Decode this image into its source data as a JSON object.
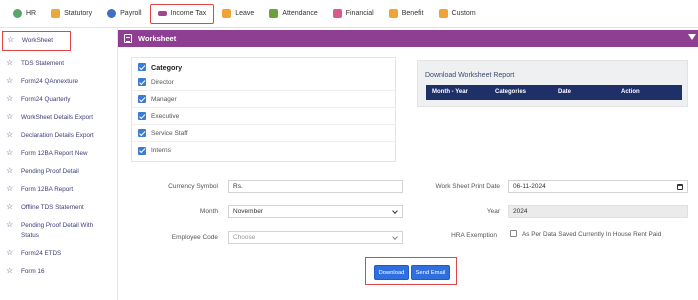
{
  "nav": {
    "items": [
      {
        "label": "HR",
        "icon": "people-icon",
        "color": "#5aa36a"
      },
      {
        "label": "Statutory",
        "icon": "document-icon",
        "color": "#e6a93a"
      },
      {
        "label": "Payroll",
        "icon": "person-money-icon",
        "color": "#3d6fc4"
      },
      {
        "label": "Income Tax",
        "icon": "tax-icon",
        "color": "#9b4a8f"
      },
      {
        "label": "Leave",
        "icon": "leave-icon",
        "color": "#f0a336"
      },
      {
        "label": "Attendance",
        "icon": "attendance-icon",
        "color": "#6aa33a"
      },
      {
        "label": "Financial",
        "icon": "financial-icon",
        "color": "#d95a8a"
      },
      {
        "label": "Benefit",
        "icon": "benefit-icon",
        "color": "#f0a336"
      },
      {
        "label": "Custom",
        "icon": "custom-icon",
        "color": "#f0a336"
      }
    ],
    "active_index": 3
  },
  "sidebar": {
    "items": [
      {
        "label": "WorkSheet"
      },
      {
        "label": "TDS Statement"
      },
      {
        "label": "Form24 QAnnexture"
      },
      {
        "label": "Form24 Quarterly"
      },
      {
        "label": "WorkSheet Details Export"
      },
      {
        "label": "Declaration Details Export"
      },
      {
        "label": "Form 12BA Report New"
      },
      {
        "label": "Pending Proof Detail"
      },
      {
        "label": "Form 12BA Report"
      },
      {
        "label": "Offline TDS Statement"
      },
      {
        "label": "Pending Proof Detail With Status"
      },
      {
        "label": "Form24 ETDS"
      },
      {
        "label": "Form 16"
      }
    ],
    "active_index": 0
  },
  "header": {
    "title": "Worksheet",
    "color": "#8e3f92"
  },
  "category": {
    "title": "Category",
    "items": [
      "Director",
      "Manager",
      "Executive",
      "Service Staff",
      "Interns"
    ]
  },
  "report": {
    "title": "Download Worksheet Report",
    "columns": [
      "Month - Year",
      "Categories",
      "Date",
      "Action"
    ]
  },
  "form": {
    "currency_symbol": {
      "label": "Currency Symbol",
      "value": "Rs."
    },
    "month": {
      "label": "Month",
      "value": "November"
    },
    "employee_code": {
      "label": "Employee Code",
      "placeholder": "Choose"
    },
    "print_date": {
      "label": "Work Sheet Print Date",
      "value": "06-11-2024"
    },
    "year": {
      "label": "Year",
      "value": "2024"
    },
    "hra": {
      "label": "HRA Exemption",
      "option": "As Per Data Saved Currently In House Rent Paid"
    }
  },
  "buttons": {
    "download": "Download",
    "send_email": "Send Email",
    "color": "#2f6fe0"
  }
}
